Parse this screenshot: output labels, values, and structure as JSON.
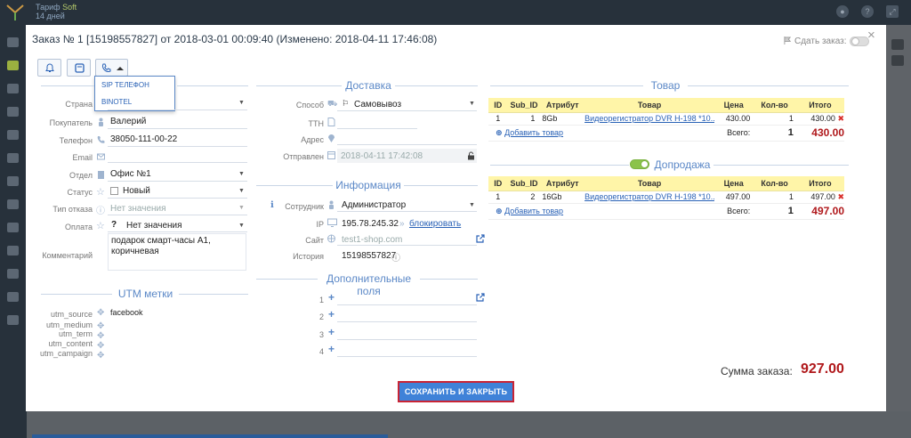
{
  "app": {
    "tariff_label": "Тариф",
    "tariff_name": "Soft",
    "days_left": "14 дней"
  },
  "modal": {
    "title": "Заказ № 1 [15198557827] от 2018-03-01 00:09:40 (Изменено: 2018-04-11 17:46:08)",
    "share_label": "Сдать заказ:",
    "close": "×"
  },
  "phone_menu": {
    "items": [
      "SIP ТЕЛЕФОН",
      "BINOTEL"
    ]
  },
  "customer": {
    "country_label": "Страна",
    "buyer_label": "Покупатель",
    "buyer_value": "Валерий",
    "phone_label": "Телефон",
    "phone_value": "38050-111-00-22",
    "email_label": "Email",
    "email_value": "",
    "dept_label": "Отдел",
    "dept_value": "Офис №1",
    "status_label": "Статус",
    "status_value": "Новый",
    "refusal_label": "Тип отказа",
    "refusal_value": "Нет значения",
    "payment_label": "Оплата",
    "payment_value": "Нет значения",
    "comment_label": "Комментарий",
    "comment_value": "подарок смарт-часы А1, коричневая"
  },
  "utm": {
    "title": "UTM метки",
    "source_label": "utm_source",
    "source_value": "facebook",
    "medium_label": "utm_medium",
    "term_label": "utm_term",
    "content_label": "utm_content",
    "campaign_label": "utm_campaign"
  },
  "delivery": {
    "title": "Доставка",
    "method_label": "Способ",
    "method_value": "Самовывоз",
    "ttn_label": "ТТН",
    "address_label": "Адрес",
    "sent_label": "Отправлен",
    "sent_value": "2018-04-11 17:42:08"
  },
  "info": {
    "title": "Информация",
    "employee_label": "Сотрудник",
    "employee_value": "Администратор",
    "ip_label": "IP",
    "ip_value": "195.78.245.32",
    "block_link": "блокировать",
    "site_label": "Сайт",
    "site_value": "test1-shop.com",
    "history_label": "История",
    "history_value": "15198557827"
  },
  "extra": {
    "title": "Дополнительные поля",
    "rows": [
      "1",
      "2",
      "3",
      "4"
    ]
  },
  "goods": {
    "title": "Товар",
    "headers": [
      "ID",
      "Sub_ID",
      "Атрибут",
      "Товар",
      "Цена",
      "Кол-во",
      "Итого"
    ],
    "row": {
      "id": "1",
      "sub_id": "1",
      "attr": "8Gb",
      "name": "Видеорегистратор DVR H-198 *10...",
      "price": "430.00",
      "qty": "1",
      "total": "430.00"
    },
    "add_label": "Добавить товар",
    "total_label": "Всего:",
    "total_qty": "1",
    "total_sum": "430.00"
  },
  "upsell": {
    "title": "Допродажа",
    "headers": [
      "ID",
      "Sub_ID",
      "Атрибут",
      "Товар",
      "Цена",
      "Кол-во",
      "Итого"
    ],
    "row": {
      "id": "1",
      "sub_id": "2",
      "attr": "16Gb",
      "name": "Видеорегистратор DVR H-198 *10...",
      "price": "497.00",
      "qty": "1",
      "total": "497.00"
    },
    "add_label": "Добавить товар",
    "total_label": "Всего:",
    "total_qty": "1",
    "total_sum": "497.00"
  },
  "order_sum": {
    "label": "Сумма заказа:",
    "value": "927.00"
  },
  "save_button": "СОХРАНИТЬ И ЗАКРЫТЬ",
  "colors": {
    "accent": "#5b88c7",
    "price_red": "#b0181b",
    "save_btn": "#3f82d8",
    "table_header": "#fff5a8",
    "toggle_on": "#8bc34a"
  }
}
